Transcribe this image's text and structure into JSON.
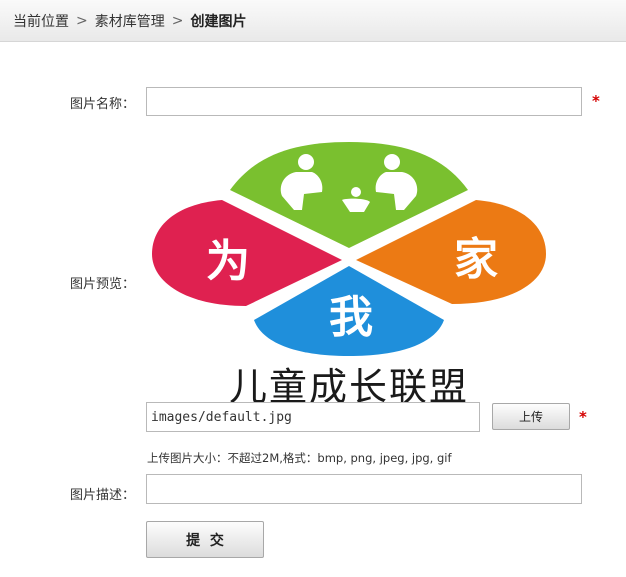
{
  "breadcrumb": {
    "items": [
      "当前位置",
      "素材库管理",
      "创建图片"
    ],
    "separator": ">"
  },
  "form": {
    "name_label": "图片名称：",
    "name_value": "",
    "required_mark": "*",
    "preview_label": "图片预览：",
    "preview_image": {
      "petal_chars": [
        "为",
        "家",
        "我"
      ],
      "caption": "儿童成长联盟",
      "colors": {
        "top": "#7ac02f",
        "left": "#df2150",
        "right": "#ec7a14",
        "bottom": "#1f8fdb"
      }
    },
    "path_value": "images/default.jpg",
    "upload_button": "上传",
    "upload_hint": "上传图片大小：不超过2M,格式：bmp, png, jpeg, jpg, gif",
    "desc_label": "图片描述：",
    "desc_value": "",
    "submit_button": "提  交"
  }
}
